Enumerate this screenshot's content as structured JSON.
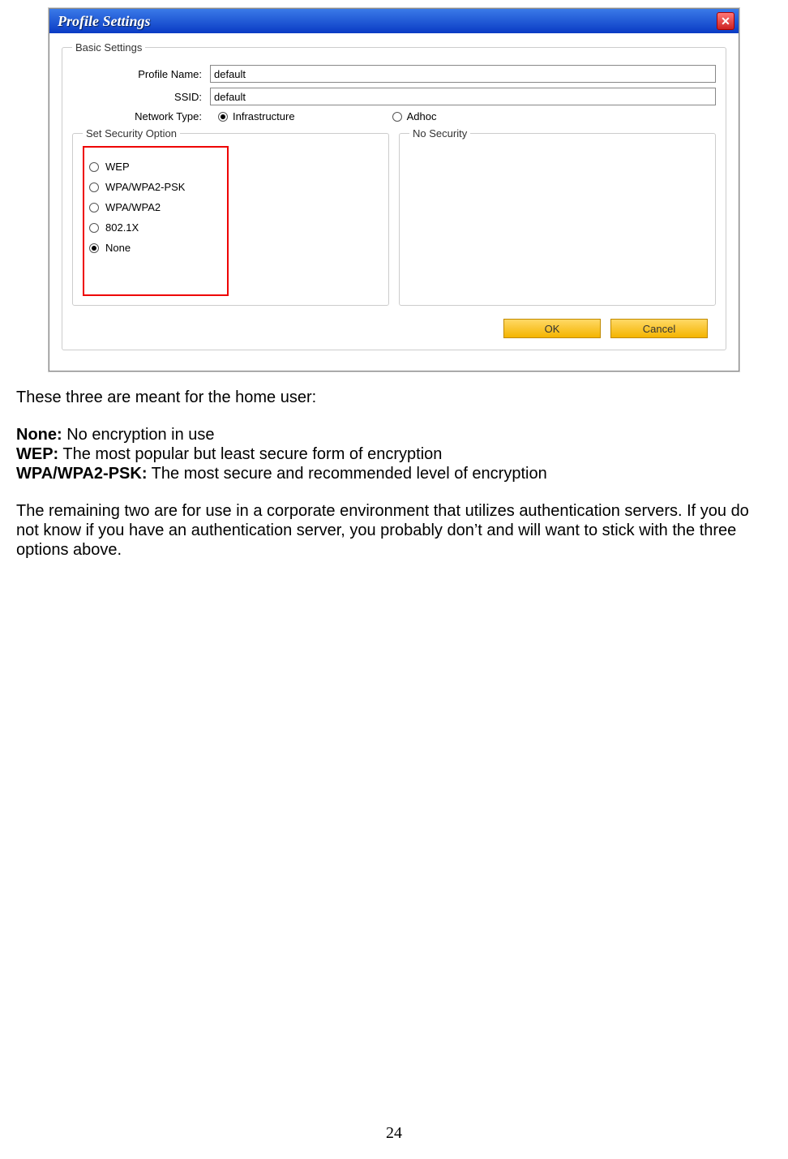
{
  "window": {
    "title": "Profile Settings",
    "basic_settings": {
      "legend": "Basic Settings",
      "profile_name_label": "Profile Name:",
      "profile_name_value": "default",
      "ssid_label": "SSID:",
      "ssid_value": "default",
      "network_type_label": "Network Type:",
      "infrastructure_label": "Infrastructure",
      "adhoc_label": "Adhoc"
    },
    "security": {
      "legend_left": "Set Security Option",
      "legend_right": "No Security",
      "options": {
        "wep": "WEP",
        "wpapsk": "WPA/WPA2-PSK",
        "wpa": "WPA/WPA2",
        "dot1x": "802.1X",
        "none": "None"
      }
    },
    "buttons": {
      "ok": "OK",
      "cancel": "Cancel"
    }
  },
  "doc": {
    "intro": "These three are meant for the home user:",
    "none_label": "None:",
    "none_desc": "  No encryption in use",
    "wep_label": "WEP:",
    "wep_desc": "  The most popular but least secure form of encryption",
    "wpa_label": "WPA/WPA2-PSK:",
    "wpa_desc": "  The most secure and recommended level of encryption",
    "outro": "The remaining two are for use in a corporate environment that utilizes authentication servers.  If you do not know if you have an authentication server, you probably don’t and will want to stick with the three options above."
  },
  "page_number": "24"
}
